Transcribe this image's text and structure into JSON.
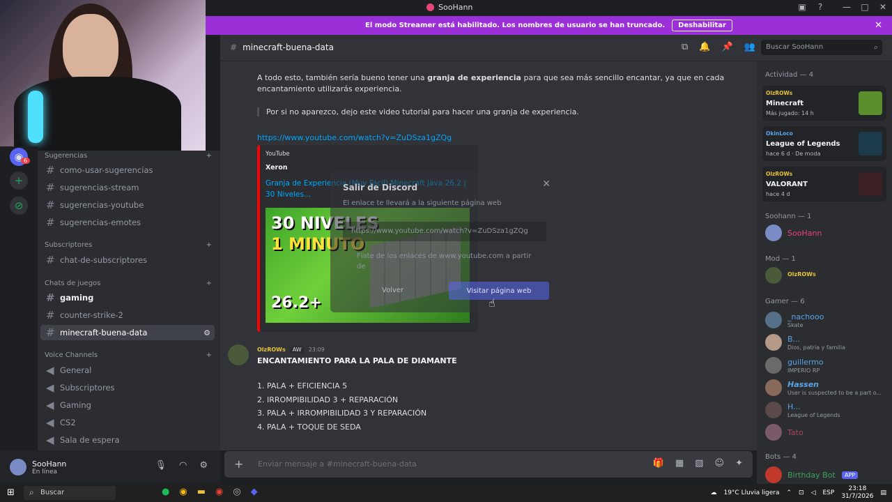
{
  "window": {
    "title": "SooHann"
  },
  "banner": {
    "text": "El modo Streamer está habilitado. Los nombres de usuario se han truncado.",
    "button": "Deshabilitar"
  },
  "servers": {
    "badge": "6"
  },
  "channels": {
    "cat_sugerencias": "Sugerencias",
    "sugerencias": [
      "como-usar-sugerencias",
      "sugerencias-stream",
      "sugerencias-youtube",
      "sugerencias-emotes"
    ],
    "cat_subscriptores": "Subscriptores",
    "subscriptores": [
      "chat-de-subscriptores"
    ],
    "cat_juegos": "Chats de juegos",
    "juegos": [
      "gaming",
      "counter-strike-2",
      "minecraft-buena-data"
    ],
    "cat_voice": "Voice Channels",
    "voice": [
      "General",
      "Subscriptores",
      "Gaming",
      "CS2",
      "Sala de espera"
    ]
  },
  "user": {
    "name": "SooHann",
    "status": "En línea"
  },
  "header": {
    "channel": "minecraft-buena-data",
    "search_placeholder": "Buscar SooHann"
  },
  "chat": {
    "msg1_pre": "A todo esto, también sería bueno tener una ",
    "msg1_bold": "granja de experiencia",
    "msg1_post": " para que sea más sencillo encantar, ya que en cada encantamiento utilizarás experiencia.",
    "quote": "Por si no aparezco, dejo este video tutorial para hacer una granja de experiencia.",
    "link": "https://www.youtube.com/watch?v=ZuDSza1gZQg",
    "embed": {
      "provider": "YouTube",
      "author": "Xeron",
      "title": "Granja de Experiencia (Muy Fácil) Minecraft Java 26.2 | 30 Niveles...",
      "thumb_l1": "30 NIVELES",
      "thumb_l2": "1 MINUTO",
      "thumb_l3": "26.2+"
    },
    "modal": {
      "title": "Salir de Discord",
      "desc": "El enlace te llevará a la siguiente página web",
      "url": "https://www.youtube.com/watch?v=ZuDSza1gZQg",
      "trust": "Fíate de los enlaces de www.youtube.com a partir de",
      "back": "Volver",
      "visit": "Visitar página web"
    },
    "msg2": {
      "author": "OlzROWs",
      "tag": "AW",
      "time": "23:09",
      "title": "ENCANTAMIENTO PARA LA PALA DE DIAMANTE",
      "items": [
        "1. PALA + EFICIENCIA 5",
        "2. IRROMPIBILIDAD 3 + REPARACIÓN",
        "3. PALA + IRROMPIBILIDAD 3 Y REPARACIÓN",
        "4. PALA + TOQUE DE SEDA"
      ]
    },
    "composer_placeholder": "Enviar mensaje a #minecraft-buena-data"
  },
  "members": {
    "activity_header": "Actividad — 4",
    "activities": [
      {
        "who": "OlzROWs",
        "game": "Minecraft",
        "sub": "Más jugado: 14 h",
        "color": "#5b8f2e"
      },
      {
        "who": "OkinLoco",
        "game": "League of Legends",
        "sub": "hace 6 d · De moda",
        "color": "#1b3a4a"
      },
      {
        "who": "OlzROWs",
        "game": "VALORANT",
        "sub": "hace 4 d",
        "color": "#ff4655"
      }
    ],
    "soohann_header": "Soohann — 1",
    "mod_header": "Mod — 1",
    "gamer_header": "Gamer — 6",
    "bots_header": "Bots — 4",
    "soohann": [
      {
        "name": "SooHann",
        "sub": "",
        "color": "#e8457a"
      }
    ],
    "mod": [
      {
        "name": "OlzROWs",
        "sub": "",
        "color": "#e5c33b"
      }
    ],
    "gamers": [
      {
        "name": "_nachooo",
        "sub": "Skate",
        "color": "#5ba4e6"
      },
      {
        "name": "B...",
        "sub": "Dios, patria y familia",
        "color": "#5ba4e6"
      },
      {
        "name": "guillermo",
        "sub": "IMPERIO RP",
        "color": "#5ba4e6"
      },
      {
        "name": "Hassen",
        "sub": "User is suspected to be a part o...",
        "color": "#5ba4e6"
      },
      {
        "name": "H...",
        "sub": "League of Legends",
        "color": "#5ba4e6"
      },
      {
        "name": "Tato",
        "sub": "",
        "color": "#e8457a"
      }
    ],
    "bots": [
      {
        "name": "Birthday Bot",
        "tag": "APP",
        "color": "#3ba55c"
      }
    ]
  },
  "taskbar": {
    "search": "Buscar",
    "weather": "19°C Lluvia ligera",
    "lang": "ESP",
    "time": "23:18",
    "date": "31/7/2026"
  }
}
